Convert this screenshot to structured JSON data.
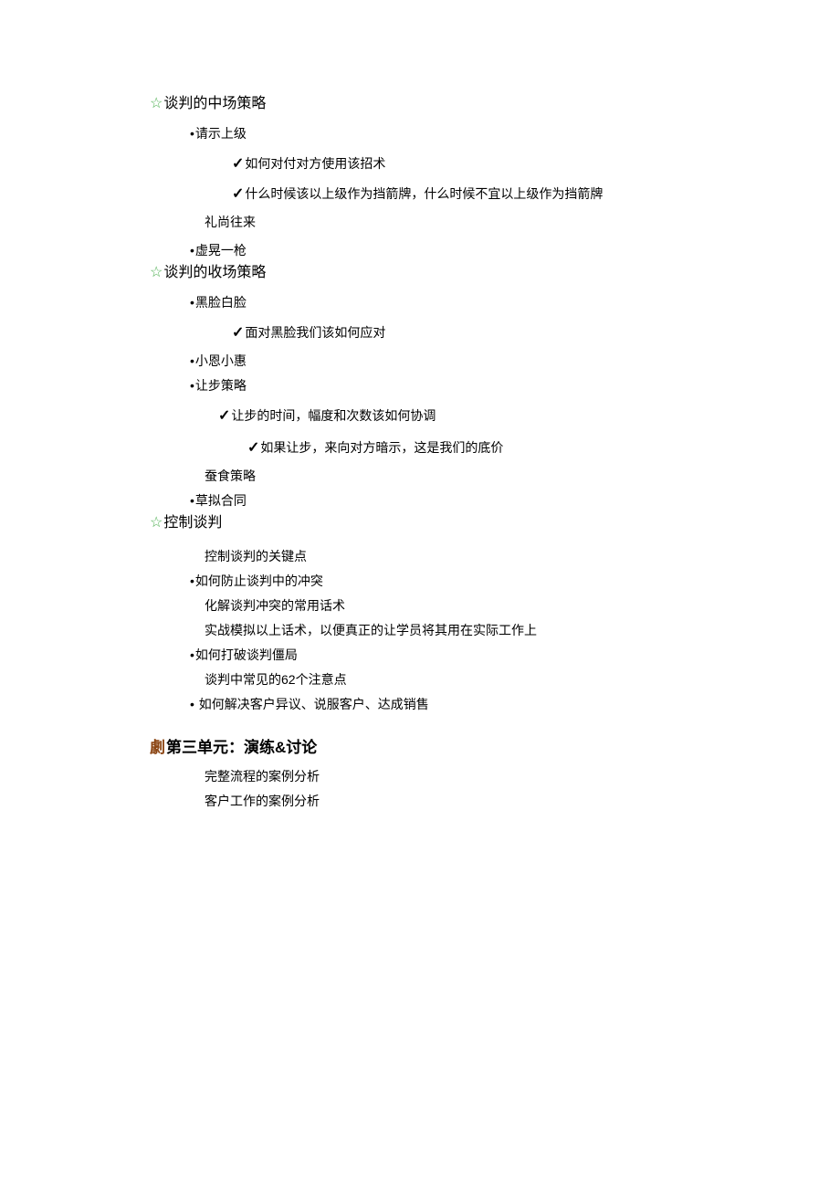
{
  "sections": {
    "s1": {
      "title": "谈判的中场策略"
    },
    "s2": {
      "title": "谈判的收场策略"
    },
    "s3": {
      "title": "控制谈判"
    }
  },
  "items": {
    "s1_b1": "请示上级",
    "s1_b1_c1": "如何对付对方使用该招术",
    "s1_b1_c2": "什么时候该以上级作为挡箭牌，什么时候不宜以上级作为挡箭牌",
    "s1_p1": "礼尚往来",
    "s1_b2": "虚晃一枪",
    "s2_b1": "黑脸白脸",
    "s2_b1_c1": "面对黑脸我们该如何应对",
    "s2_b2": "小恩小惠",
    "s2_b3": "让步策略",
    "s2_b3_c1": "让步的时间，幅度和次数该如何协调",
    "s2_b3_c2": "如果让步，来向对方暗示，这是我们的底价",
    "s2_p1": "蚕食策略",
    "s2_b4": "草拟合同",
    "s3_p1": "控制谈判的关键点",
    "s3_b1": "如何防止谈判中的冲突",
    "s3_b1_p1": "化解谈判冲突的常用话术",
    "s3_b1_p2": "实战模拟以上话术，以便真正的让学员将其用在实际工作上",
    "s3_b2": "如何打破谈判僵局",
    "s3_b2_p1": "谈判中常见的62个注意点",
    "s3_b3": "如何解决客户异议、说服客户、达成销售"
  },
  "unit3": {
    "icon": "劇",
    "title": "第三单元：演练&讨论",
    "p1": "完整流程的案例分析",
    "p2": "客户工作的案例分析"
  }
}
